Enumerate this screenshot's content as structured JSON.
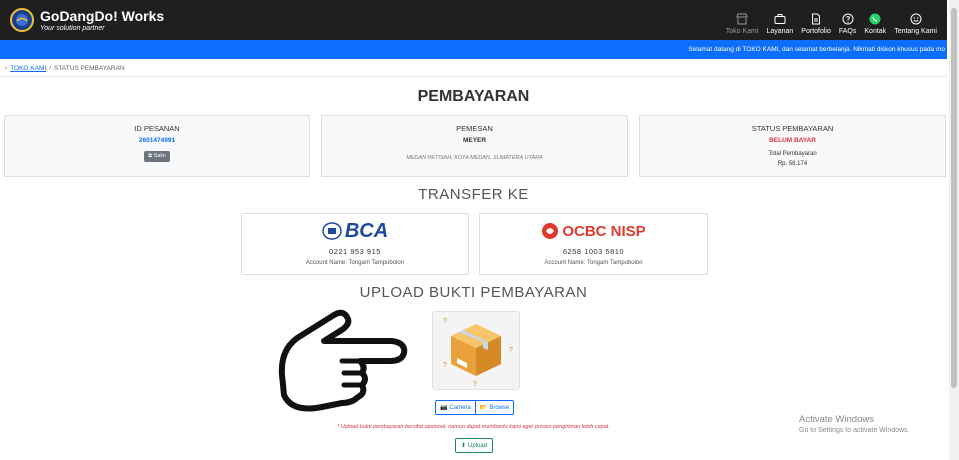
{
  "navbar": {
    "brand_name": "GoDangDo! Works",
    "brand_tagline": "Your solution partner",
    "items": [
      {
        "label": "Toko Kami",
        "icon": "store-icon",
        "muted": true
      },
      {
        "label": "Layanan",
        "icon": "briefcase-icon",
        "muted": false
      },
      {
        "label": "Portofolio",
        "icon": "document-icon",
        "muted": false
      },
      {
        "label": "FAQs",
        "icon": "question-icon",
        "muted": false
      },
      {
        "label": "Kontak",
        "icon": "whatsapp-icon",
        "muted": false
      },
      {
        "label": "Tentang Kami",
        "icon": "smile-icon",
        "muted": false
      }
    ]
  },
  "marquee": {
    "text": "Selamat datang di TOKO KAMI, dan selamat berbelanja. Nikmati diskon khusus pada mo"
  },
  "breadcrumb": {
    "home": "TOKO KAMI",
    "separator": "/",
    "current": "STATUS PEMBAYARAN"
  },
  "page_title": "PEMBAYARAN",
  "order": {
    "heading": "ID PESANAN",
    "id": "2601474991",
    "share_label": "Salin"
  },
  "customer": {
    "heading": "PEMESAN",
    "name": "MEYER",
    "address": "MEDAN PETISAH, KOTA MEDAN, SUMATERA UTARA"
  },
  "payment_status": {
    "heading": "STATUS PEMBAYARAN",
    "status": "BELUM BAYAR",
    "total_label": "Total Pembayaran",
    "total_value": "Rp. 58.174"
  },
  "transfer": {
    "title": "TRANSFER KE",
    "banks": [
      {
        "logo_text": "BCA",
        "account": "0221 953 915",
        "holder": "Account Name: Tongam Tampubolon"
      },
      {
        "logo_text": "OCBC NISP",
        "account": "6258 1003 5810",
        "holder": "Account Name: Tongam Tampubolon"
      }
    ]
  },
  "upload": {
    "title": "UPLOAD BUKTI PEMBAYARAN",
    "camera_label": "Camera",
    "browse_label": "Browse",
    "note": "* Upload bukti pembayaran bersifat opsional, namun dapat membantu kami agar proses pengiriman lebih cepat.",
    "upload_label": "Upload"
  },
  "watermark": {
    "line1": "Activate Windows",
    "line2": "Go to Settings to activate Windows."
  },
  "colors": {
    "navbar": "#1f1f1f",
    "marquee": "#0d6efd",
    "status": "#dc3545",
    "link": "#0d6efd",
    "upload": "#198754"
  }
}
